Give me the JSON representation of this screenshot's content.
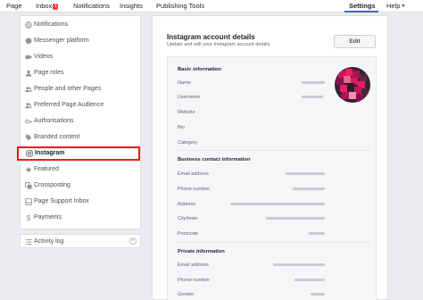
{
  "topnav": {
    "page": "Page",
    "inbox": "Inbox",
    "inbox_badge": "1",
    "notifications": "Notifications",
    "insights": "Insights",
    "publishing_tools": "Publishing Tools",
    "settings": "Settings",
    "help": "Help"
  },
  "sidebar": {
    "items": [
      {
        "label": "Notifications",
        "icon": "globe-icon"
      },
      {
        "label": "Messenger platform",
        "icon": "messenger-icon"
      },
      {
        "label": "Videos",
        "icon": "video-icon"
      },
      {
        "label": "Page roles",
        "icon": "person-icon"
      },
      {
        "label": "People and other Pages",
        "icon": "people-icon"
      },
      {
        "label": "Preferred Page Audience",
        "icon": "people-icon"
      },
      {
        "label": "Authorisations",
        "icon": "key-icon"
      },
      {
        "label": "Branded content",
        "icon": "tag-icon"
      },
      {
        "label": "Instagram",
        "icon": "instagram-icon"
      },
      {
        "label": "Featured",
        "icon": "star-icon"
      },
      {
        "label": "Crossposting",
        "icon": "crossposting-icon"
      },
      {
        "label": "Page Support Inbox",
        "icon": "inbox-icon"
      },
      {
        "label": "Payments",
        "icon": "dollar-icon"
      }
    ],
    "selected": "Instagram",
    "activity_log": "Activity log",
    "activity_log_action": "+"
  },
  "main": {
    "title": "Instagram account details",
    "subtitle": "Update and edit your Instagram account details.",
    "edit_label": "Edit",
    "sections": {
      "basic": "Basic information",
      "contact": "Business contact information",
      "private": "Private information"
    },
    "basic_fields": [
      "Name",
      "Username",
      "Website",
      "Bio",
      "Category"
    ],
    "contact_fields": [
      "Email address",
      "Phone number",
      "Address",
      "City/town",
      "Postcode"
    ],
    "private_fields": [
      "Email address",
      "Phone number",
      "Gender"
    ]
  },
  "colors": {
    "accent": "#4267b2",
    "highlight_border": "#e0201e",
    "badge": "#fa3e3e"
  }
}
